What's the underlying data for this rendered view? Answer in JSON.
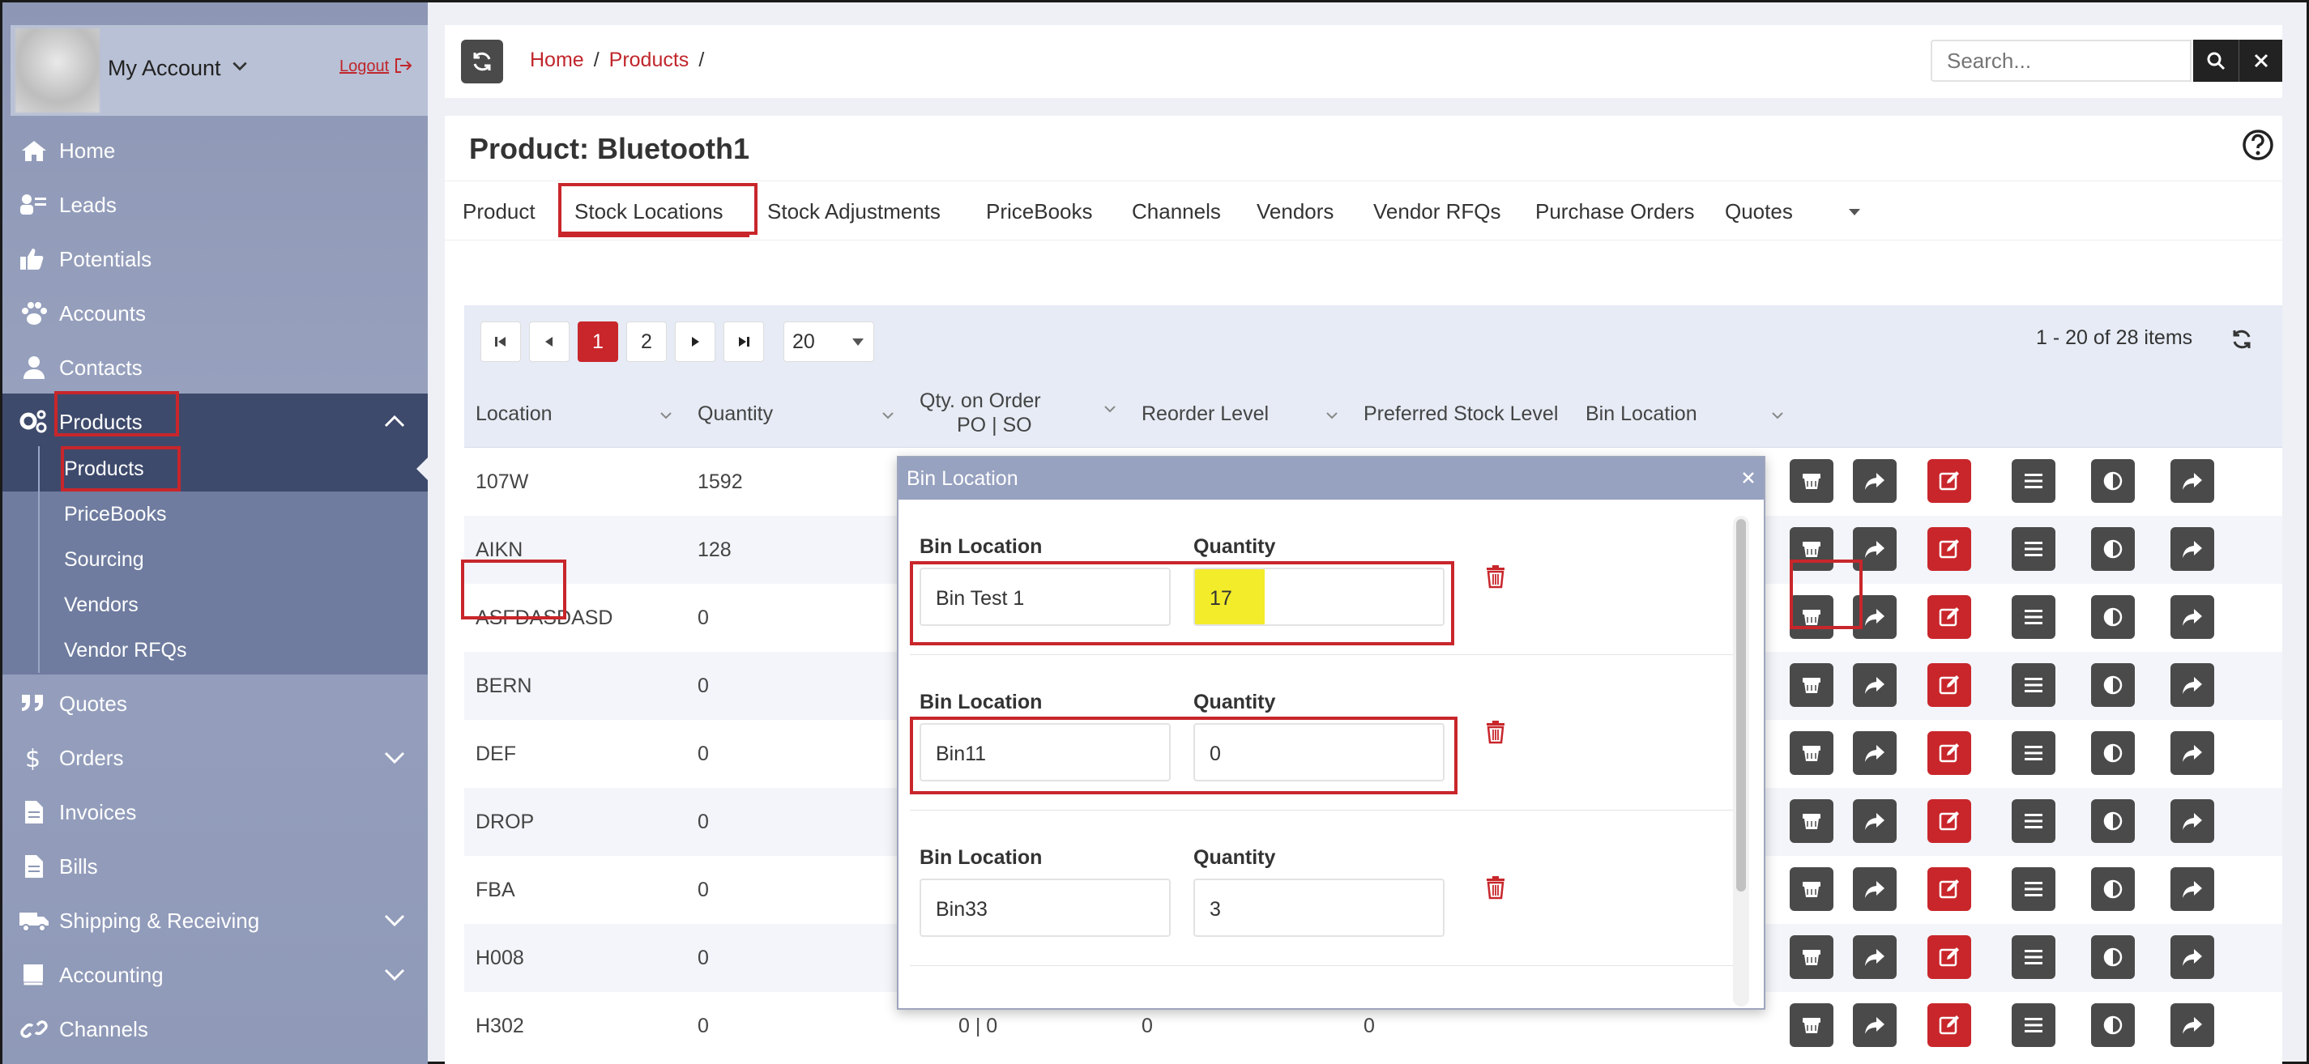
{
  "account": {
    "name": "My Account",
    "logout": "Logout"
  },
  "nav": [
    {
      "id": "home",
      "label": "Home",
      "icon": "home-icon"
    },
    {
      "id": "leads",
      "label": "Leads",
      "icon": "leads-icon"
    },
    {
      "id": "potentials",
      "label": "Potentials",
      "icon": "thumbs-up-icon"
    },
    {
      "id": "accounts",
      "label": "Accounts",
      "icon": "paw-icon"
    },
    {
      "id": "contacts",
      "label": "Contacts",
      "icon": "user-icon"
    },
    {
      "id": "products",
      "label": "Products",
      "icon": "gears-icon"
    },
    {
      "id": "quotes",
      "label": "Quotes",
      "icon": "quote-icon"
    },
    {
      "id": "orders",
      "label": "Orders",
      "icon": "dollar-icon"
    },
    {
      "id": "invoices",
      "label": "Invoices",
      "icon": "file-icon"
    },
    {
      "id": "bills",
      "label": "Bills",
      "icon": "file-icon"
    },
    {
      "id": "shipping",
      "label": "Shipping & Receiving",
      "icon": "truck-icon"
    },
    {
      "id": "accounting",
      "label": "Accounting",
      "icon": "book-icon"
    },
    {
      "id": "channels",
      "label": "Channels",
      "icon": "link-icon"
    }
  ],
  "products_sub": [
    "Products",
    "PriceBooks",
    "Sourcing",
    "Vendors",
    "Vendor RFQs"
  ],
  "breadcrumb": {
    "home": "Home",
    "products": "Products",
    "sep": "/"
  },
  "search": {
    "placeholder": "Search..."
  },
  "page_title": "Product: Bluetooth1",
  "tabs": [
    "Product",
    "Stock Locations",
    "Stock Adjustments",
    "PriceBooks",
    "Channels",
    "Vendors",
    "Vendor RFQs",
    "Purchase Orders",
    "Quotes"
  ],
  "pager": {
    "pages": [
      "1",
      "2"
    ],
    "page_size": "20",
    "items_text": "1 - 20 of 28 items"
  },
  "columns": {
    "location": "Location",
    "quantity": "Quantity",
    "qty_on_order": "Qty. on Order",
    "qty_on_order_sub": "PO | SO",
    "reorder": "Reorder Level",
    "preferred": "Preferred Stock Level",
    "bin": "Bin Location"
  },
  "rows": [
    {
      "location": "107W",
      "quantity": "1592"
    },
    {
      "location": "AIKN",
      "quantity": "128"
    },
    {
      "location": "ASFDASDASD",
      "quantity": "0"
    },
    {
      "location": "BERN",
      "quantity": "0"
    },
    {
      "location": "DEF",
      "quantity": "0"
    },
    {
      "location": "DROP",
      "quantity": "0"
    },
    {
      "location": "FBA",
      "quantity": "0"
    },
    {
      "location": "H008",
      "quantity": "0"
    },
    {
      "location": "H302",
      "quantity": "0",
      "qty_on_order": "0 | 0",
      "reorder": "0",
      "preferred": "0"
    }
  ],
  "modal": {
    "title": "Bin Location",
    "bin_label": "Bin Location",
    "qty_label": "Quantity",
    "entries": [
      {
        "bin": "Bin Test 1",
        "qty": "17"
      },
      {
        "bin": "Bin11",
        "qty": "0"
      },
      {
        "bin": "Bin33",
        "qty": "3"
      }
    ]
  },
  "colors": {
    "accent": "#c8262b",
    "sidebar": "#8d97b5",
    "sidebar_active": "#3e4a6c",
    "highlight": "#f3ec2a"
  }
}
